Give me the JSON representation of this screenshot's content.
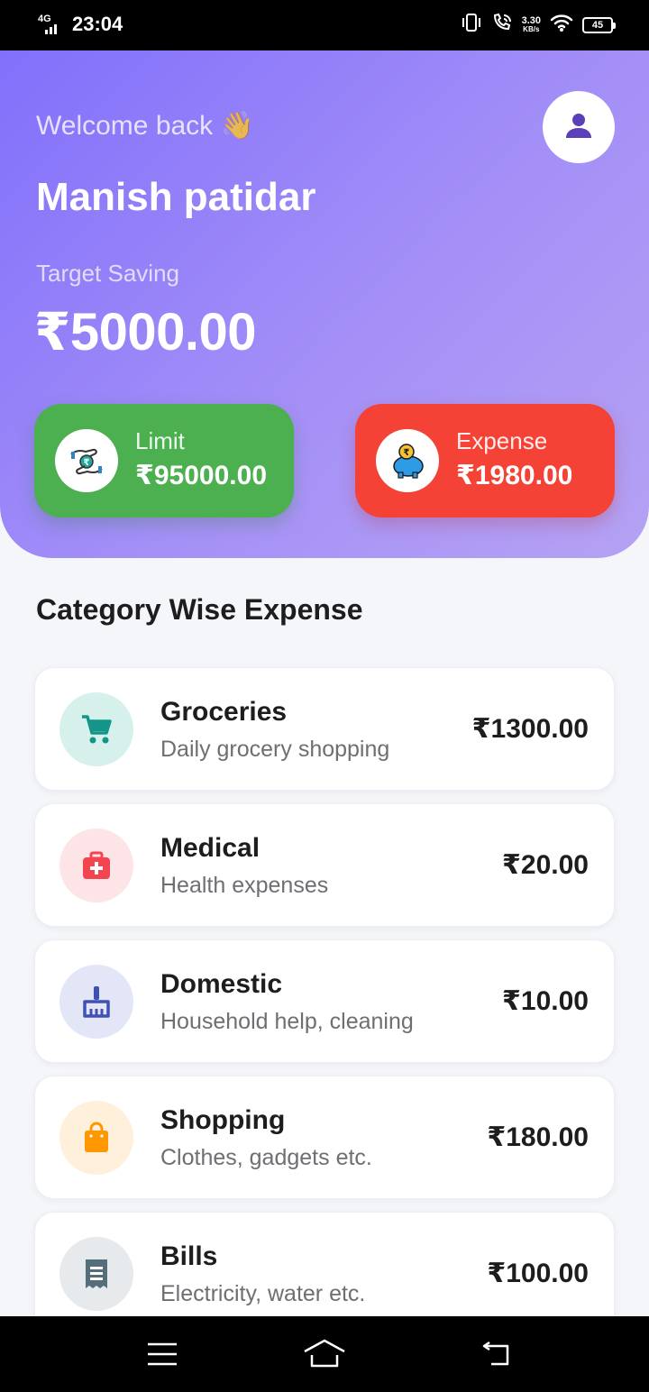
{
  "status_bar": {
    "network": "4G",
    "time": "23:04",
    "speed_value": "3.30",
    "speed_unit": "KB/s",
    "battery": "45"
  },
  "header": {
    "welcome": "Welcome back 👋",
    "user_name": "Manish patidar",
    "target_label": "Target Saving",
    "target_amount": "₹5000.00",
    "avatar_icon": "person-icon"
  },
  "stats": {
    "limit": {
      "label": "Limit",
      "value": "₹95000.00",
      "icon": "money-hands-icon",
      "color": "#4caf50"
    },
    "expense": {
      "label": "Expense",
      "value": "₹1980.00",
      "icon": "piggy-bank-icon",
      "color": "#f44336"
    }
  },
  "section_title": "Category Wise Expense",
  "categories": [
    {
      "name": "Groceries",
      "desc": "Daily grocery shopping",
      "amount": "₹1300.00",
      "icon": "cart-icon",
      "color": "#14958a",
      "bg": "#d6f0ec"
    },
    {
      "name": "Medical",
      "desc": "Health expenses",
      "amount": "₹20.00",
      "icon": "medkit-icon",
      "color": "#f2454f",
      "bg": "#fde4e6"
    },
    {
      "name": "Domestic",
      "desc": "Household help, cleaning",
      "amount": "₹10.00",
      "icon": "broom-icon",
      "color": "#3f51b5",
      "bg": "#e3e6f6"
    },
    {
      "name": "Shopping",
      "desc": "Clothes, gadgets etc.",
      "amount": "₹180.00",
      "icon": "shopping-bag-icon",
      "color": "#ff9800",
      "bg": "#fff0dc"
    },
    {
      "name": "Bills",
      "desc": "Electricity, water etc.",
      "amount": "₹100.00",
      "icon": "receipt-icon",
      "color": "#546e7a",
      "bg": "#e6eaed"
    }
  ],
  "nav": {
    "menu_icon": "menu-icon",
    "home_icon": "home-icon",
    "back_icon": "back-icon"
  }
}
